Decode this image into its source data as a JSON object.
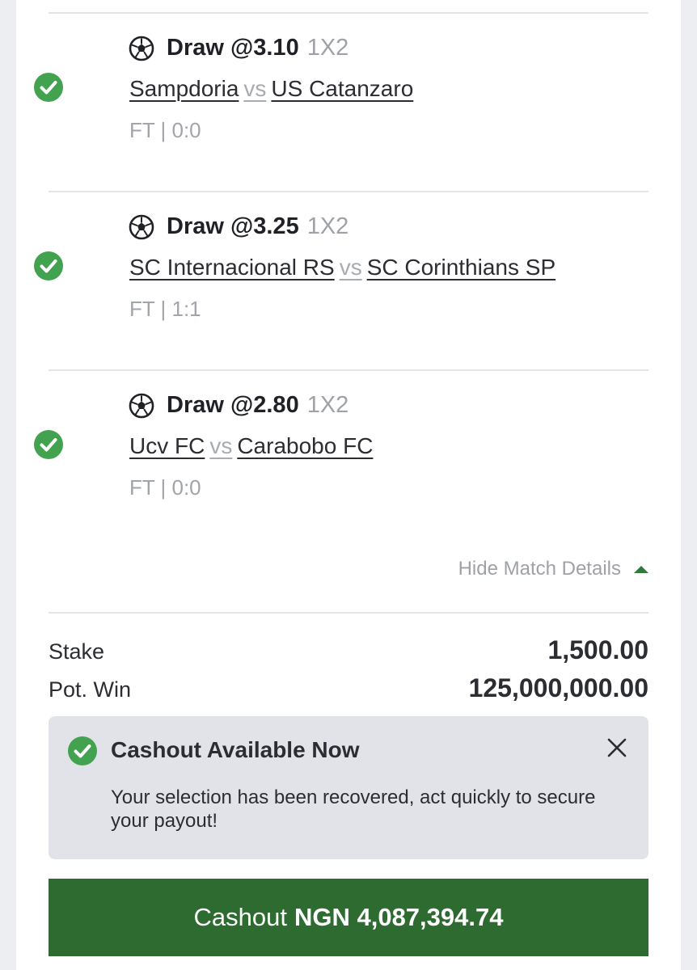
{
  "colors": {
    "accent_green": "#2e6b30",
    "check_green": "#43a24f",
    "muted_text": "#9ea1a8",
    "notice_bg": "#e2e3e8"
  },
  "selections": [
    {
      "status_icon": "check-circle-icon",
      "sport_icon": "soccer-ball-icon",
      "pick": "Draw @3.10",
      "market": "1X2",
      "home": "Sampdoria",
      "vs": "vs",
      "away": "US Catanzaro",
      "result": "FT | 0:0"
    },
    {
      "status_icon": "check-circle-icon",
      "sport_icon": "soccer-ball-icon",
      "pick": "Draw @3.25",
      "market": "1X2",
      "home": "SC Internacional RS",
      "vs": "vs",
      "away": "SC Corinthians SP",
      "result": "FT | 1:1"
    },
    {
      "status_icon": "check-circle-icon",
      "sport_icon": "soccer-ball-icon",
      "pick": "Draw @2.80",
      "market": "1X2",
      "home": "Ucv FC",
      "vs": "vs",
      "away": "Carabobo FC",
      "result": "FT | 0:0"
    }
  ],
  "details_toggle": {
    "label": "Hide Match Details",
    "icon": "caret-up-icon"
  },
  "summary": {
    "stake_label": "Stake",
    "stake_value": "1,500.00",
    "potwin_label": "Pot. Win",
    "potwin_value": "125,000,000.00"
  },
  "notice": {
    "icon": "check-circle-icon",
    "title": "Cashout Available Now",
    "body": "Your selection has been recovered, act quickly to secure your payout!",
    "close_icon": "close-icon"
  },
  "cashout_button": {
    "label": "Cashout",
    "amount": "NGN 4,087,394.74"
  }
}
